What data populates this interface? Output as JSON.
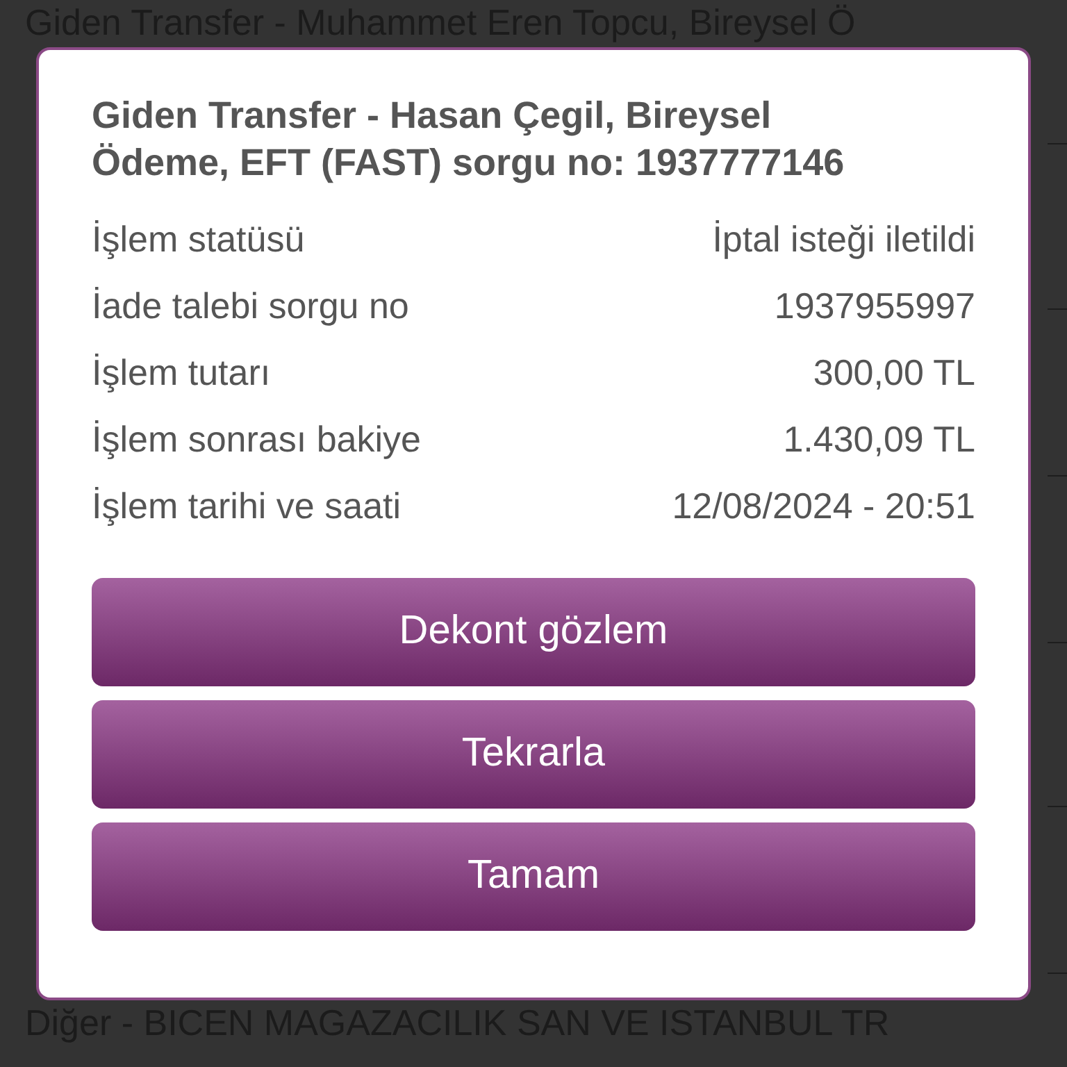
{
  "background_list": {
    "top_item": "Giden Transfer - Muhammet Eren Topcu, Bireysel Ö",
    "bottom_item": "Diğer - BICEN MAGAZACILIK SAN VE ISTANBUL TR"
  },
  "dialog": {
    "title": "Giden Transfer - Hasan Çegil, Bireysel Ödeme, EFT (FAST) sorgu no: 1937777146",
    "rows": [
      {
        "label": "İşlem statüsü",
        "value": "İptal isteği iletildi"
      },
      {
        "label": "İade talebi sorgu no",
        "value": "1937955997"
      },
      {
        "label": "İşlem tutarı",
        "value": "300,00 TL"
      },
      {
        "label": "İşlem sonrası bakiye",
        "value": "1.430,09 TL"
      },
      {
        "label": "İşlem tarihi ve saati",
        "value": "12/08/2024 - 20:51"
      }
    ],
    "buttons": [
      "Dekont gözlem",
      "Tekrarla",
      "Tamam"
    ]
  }
}
